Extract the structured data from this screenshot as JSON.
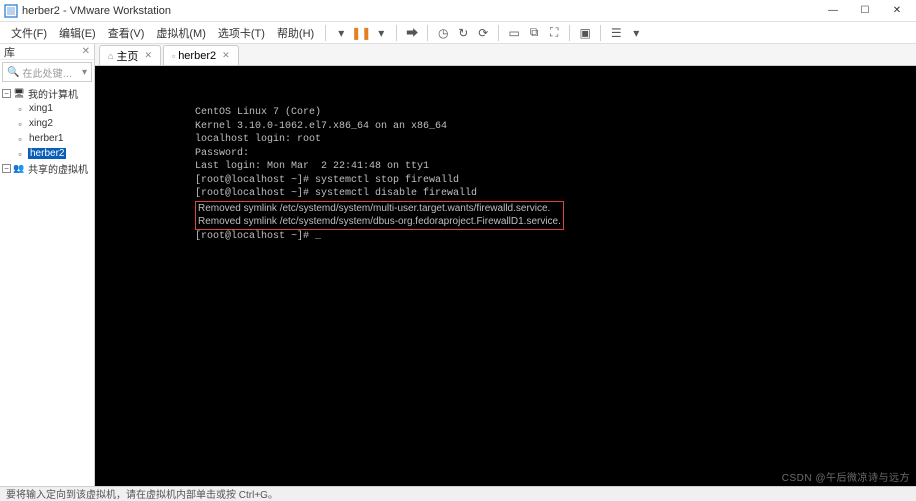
{
  "window": {
    "title": "herber2 - VMware Workstation",
    "min": "—",
    "max": "☐",
    "close": "✕"
  },
  "menu": {
    "file": "文件(F)",
    "edit": "编辑(E)",
    "view": "查看(V)",
    "vm": "虚拟机(M)",
    "tabs": "选项卡(T)",
    "help": "帮助(H)"
  },
  "sidebar": {
    "header": "库",
    "close": "✕",
    "search_placeholder": "在此处键入内容进行搜索",
    "root": "我的计算机",
    "items": [
      {
        "label": "xing1"
      },
      {
        "label": "xing2"
      },
      {
        "label": "herber1"
      },
      {
        "label": "herber2",
        "selected": true
      },
      {
        "label": "共享的虚拟机"
      }
    ]
  },
  "tabs": {
    "home_icon": "⌂",
    "home": "主页",
    "vm": "herber2"
  },
  "terminal": {
    "l1": "CentOS Linux 7 (Core)",
    "l2": "Kernel 3.10.0-1062.el7.x86_64 on an x86_64",
    "l3": "",
    "l4": "localhost login: root",
    "l5": "Password:",
    "l6": "Last login: Mon Mar  2 22:41:48 on tty1",
    "l7": "[root@localhost ~]# systemctl stop firewalld",
    "l8": "[root@localhost ~]# systemctl disable firewalld",
    "l9a": "Removed symlink /etc/systemd/system/multi-user.target.wants/firewalld.service.",
    "l9b": "Removed symlink /etc/systemd/system/dbus-org.fedoraproject.FirewallD1.service.",
    "l10": "[root@localhost ~]# _"
  },
  "status": {
    "text": "要将输入定向到该虚拟机，请在虚拟机内部单击或按 Ctrl+G。"
  },
  "watermark": "CSDN @午后微凉诗与远方"
}
